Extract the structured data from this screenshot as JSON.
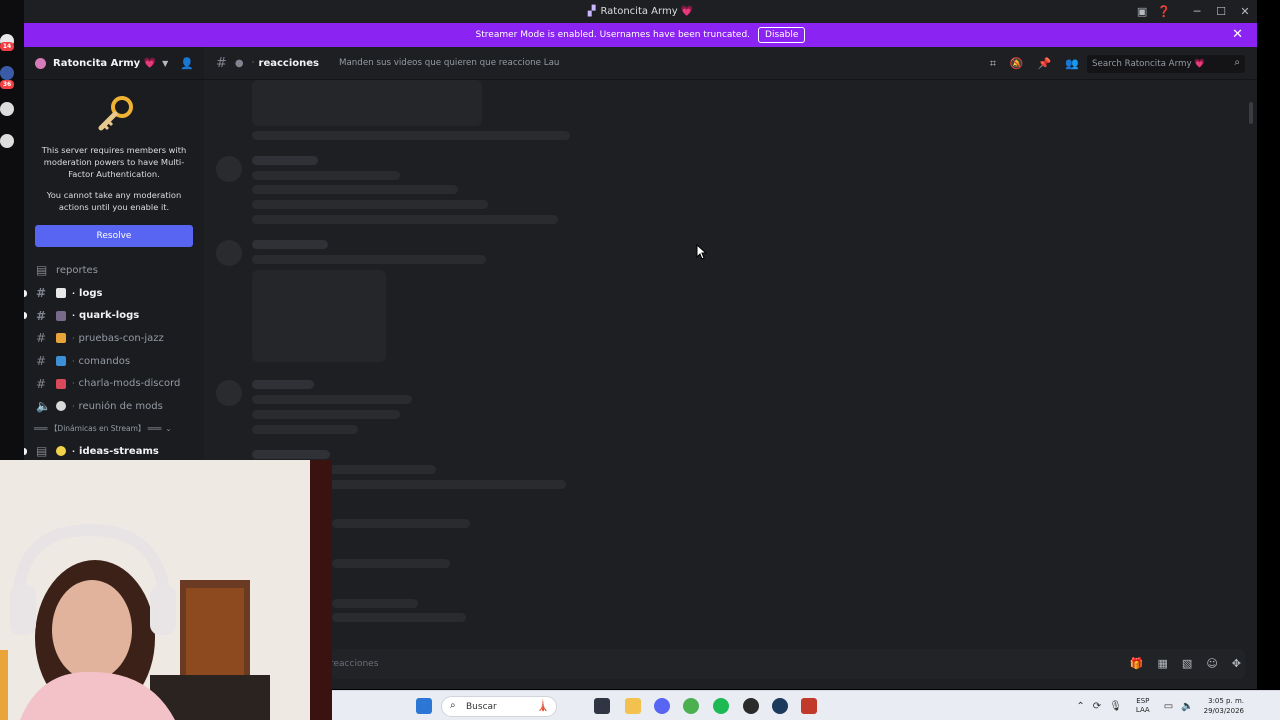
{
  "window": {
    "title": "Ratoncita Army 💗"
  },
  "rail": {
    "badge_top": "14",
    "badge_mid": "36"
  },
  "streamer_bar": {
    "message": "Streamer Mode is enabled. Usernames have been truncated.",
    "disable_label": "Disable",
    "bg_color": "#8b24f2"
  },
  "server": {
    "name": "Ratoncita Army 💗"
  },
  "mfa_notice": {
    "line1": "This server requires members with moderation powers to have Multi-Factor Authentication.",
    "line2": "You cannot take any moderation actions until you enable it.",
    "resolve_label": "Resolve"
  },
  "channels": [
    {
      "name": "reportes",
      "unread": false,
      "icon": "forum-icon"
    },
    {
      "name": "logs",
      "unread": true,
      "icon": "hash-icon",
      "emoji": "📄"
    },
    {
      "name": "quark-logs",
      "unread": true,
      "icon": "hash-icon",
      "emoji": "🕵️"
    },
    {
      "name": "pruebas-con-jazz",
      "unread": false,
      "icon": "hash-icon",
      "emoji": "😺"
    },
    {
      "name": "comandos",
      "unread": false,
      "icon": "hash-icon",
      "emoji": "📘"
    },
    {
      "name": "charla-mods-discord",
      "unread": false,
      "icon": "hash-icon",
      "emoji": "📢"
    },
    {
      "name": "reunión de mods",
      "unread": false,
      "icon": "speaker-icon",
      "emoji": "🕒"
    }
  ],
  "category": {
    "label": "═══ 【Dinámicas en Stream】 ═══"
  },
  "category_channels": [
    {
      "name": "ideas-streams",
      "unread": true,
      "emoji": "💡"
    }
  ],
  "channel_header": {
    "name": "reacciones",
    "topic": "Manden sus videos que quieren que reaccione Lau",
    "search_placeholder": "Search Ratoncita Army 💗"
  },
  "composer": {
    "placeholder": "reacciones"
  },
  "taskbar": {
    "search_label": "Buscar",
    "lang_top": "ESP",
    "lang_bottom": "LAA",
    "time": "3:05 p. m.",
    "date": "29/03/2026"
  },
  "colors": {
    "accent": "#5865f2",
    "streamer": "#8b24f2",
    "bg": "#1e1f22",
    "sidebar": "#1b1c20"
  }
}
